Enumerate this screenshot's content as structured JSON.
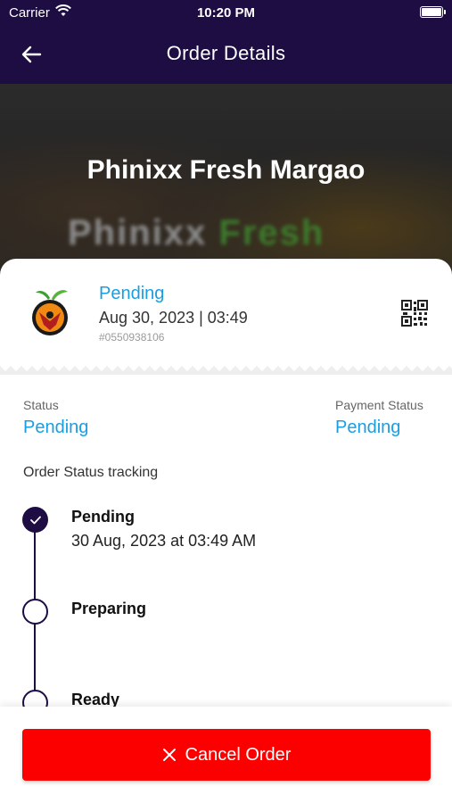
{
  "status_bar": {
    "carrier": "Carrier",
    "time": "10:20 PM"
  },
  "nav": {
    "title": "Order Details",
    "back_icon": "arrow-left-icon"
  },
  "hero": {
    "store_name": "Phinixx Fresh Margao",
    "watermark_a": "Phinixx",
    "watermark_b": "Fresh"
  },
  "order": {
    "state": "Pending",
    "date": "Aug 30, 2023 | 03:49",
    "id": "#0550938106",
    "qr_icon": "qr-code-icon"
  },
  "status": {
    "label": "Status",
    "value": "Pending",
    "payment_label": "Payment Status",
    "payment_value": "Pending"
  },
  "tracking": {
    "title": "Order Status tracking",
    "steps": [
      {
        "label": "Pending",
        "time": "30 Aug, 2023 at 03:49 AM",
        "done": true
      },
      {
        "label": "Preparing",
        "done": false
      },
      {
        "label": "Ready",
        "done": false
      }
    ]
  },
  "actions": {
    "cancel_label": "Cancel Order",
    "cancel_icon": "close-icon"
  },
  "colors": {
    "header": "#1e0d43",
    "accent": "#1a9ee2",
    "danger": "#fc0000"
  }
}
